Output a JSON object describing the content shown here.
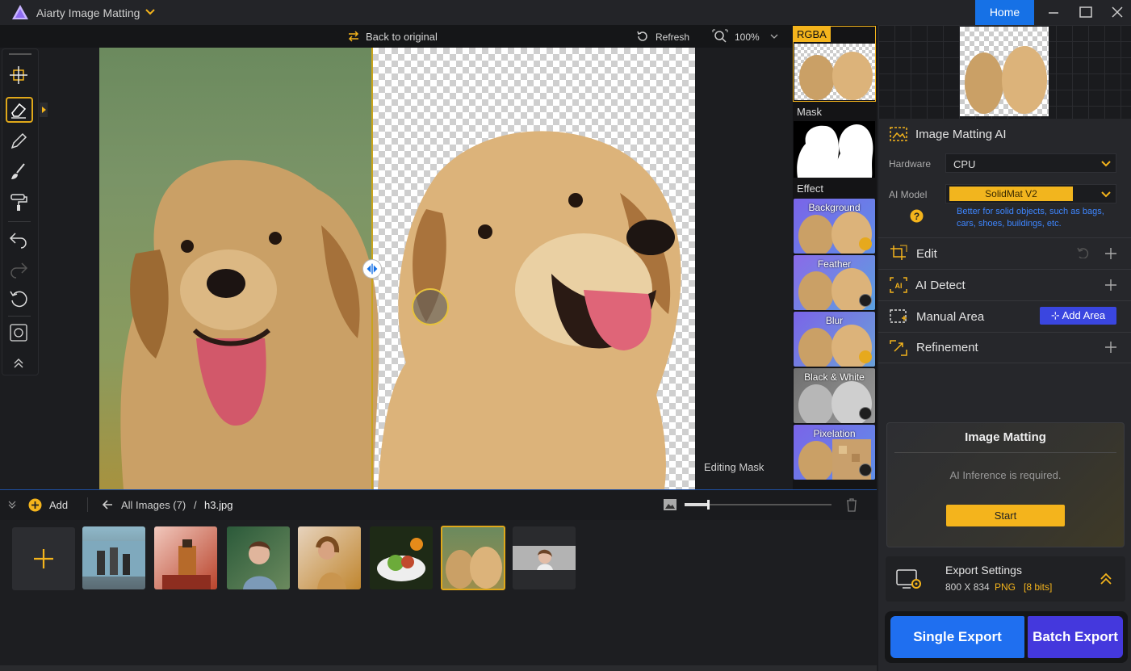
{
  "app": {
    "title": "Aiarty Image Matting",
    "home_label": "Home"
  },
  "canvas_bar": {
    "back_label": "Back to original",
    "refresh_label": "Refresh",
    "zoom": "100%"
  },
  "canvas": {
    "editing_label": "Editing Mask"
  },
  "strip": {
    "rgba_label": "RGBA",
    "mask_label": "Mask",
    "effect_label": "Effect",
    "effects": [
      {
        "label": "Background",
        "checked": true
      },
      {
        "label": "Feather",
        "checked": false
      },
      {
        "label": "Blur",
        "checked": true
      },
      {
        "label": "Black & White",
        "checked": false
      },
      {
        "label": "Pixelation",
        "checked": false
      }
    ]
  },
  "panel": {
    "matting_title": "Image Matting AI",
    "hardware_label": "Hardware",
    "hardware_value": "CPU",
    "model_label": "AI Model",
    "model_value": "SolidMat  V2",
    "model_note": "Better for solid objects, such as bags, cars, shoes, buildings, etc.",
    "sections": [
      {
        "label": "Edit"
      },
      {
        "label": "AI Detect"
      },
      {
        "label": "Manual Area"
      },
      {
        "label": "Refinement"
      }
    ],
    "add_area_label": "Add Area"
  },
  "matting_card": {
    "title": "Image Matting",
    "message": "AI Inference is required.",
    "start_label": "Start"
  },
  "export": {
    "title": "Export Settings",
    "size": "800 X 834",
    "format": "PNG",
    "bits": "[8 bits]"
  },
  "export_buttons": {
    "single": "Single Export",
    "batch": "Batch Export"
  },
  "gallery": {
    "add_label": "Add",
    "all_images": "All Images (7)",
    "separator": "/",
    "current_file": "h3.jpg"
  },
  "colors": {
    "accent": "#f4b41c",
    "primary_blue": "#1671e6",
    "batch_purple": "#4438dd"
  }
}
